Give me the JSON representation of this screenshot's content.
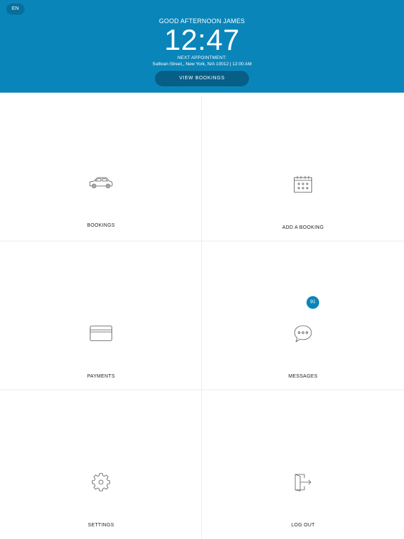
{
  "header": {
    "language": "EN",
    "greeting": "GOOD AFTERNOON JAMES",
    "clock": "12:47",
    "appointment_label": "NEXT APPOINTMENT:",
    "appointment_detail": "Sullivan Street,, New York, N/A 10012 | 12:00 AM",
    "view_bookings_label": "VIEW BOOKINGS"
  },
  "tiles": [
    {
      "label": "BOOKINGS",
      "icon": "car-icon"
    },
    {
      "label": "ADD A BOOKING",
      "icon": "calendar-icon"
    },
    {
      "label": "PAYMENTS",
      "icon": "credit-card-icon"
    },
    {
      "label": "MESSAGES",
      "icon": "chat-bubble-icon",
      "badge": "91"
    },
    {
      "label": "SETTINGS",
      "icon": "gear-icon"
    },
    {
      "label": "LOG OUT",
      "icon": "logout-icon"
    }
  ],
  "colors": {
    "header_background": "#0a85b9",
    "button_background": "#075e86",
    "badge_background": "#0a85b9",
    "tile_background": "#ffffff"
  }
}
